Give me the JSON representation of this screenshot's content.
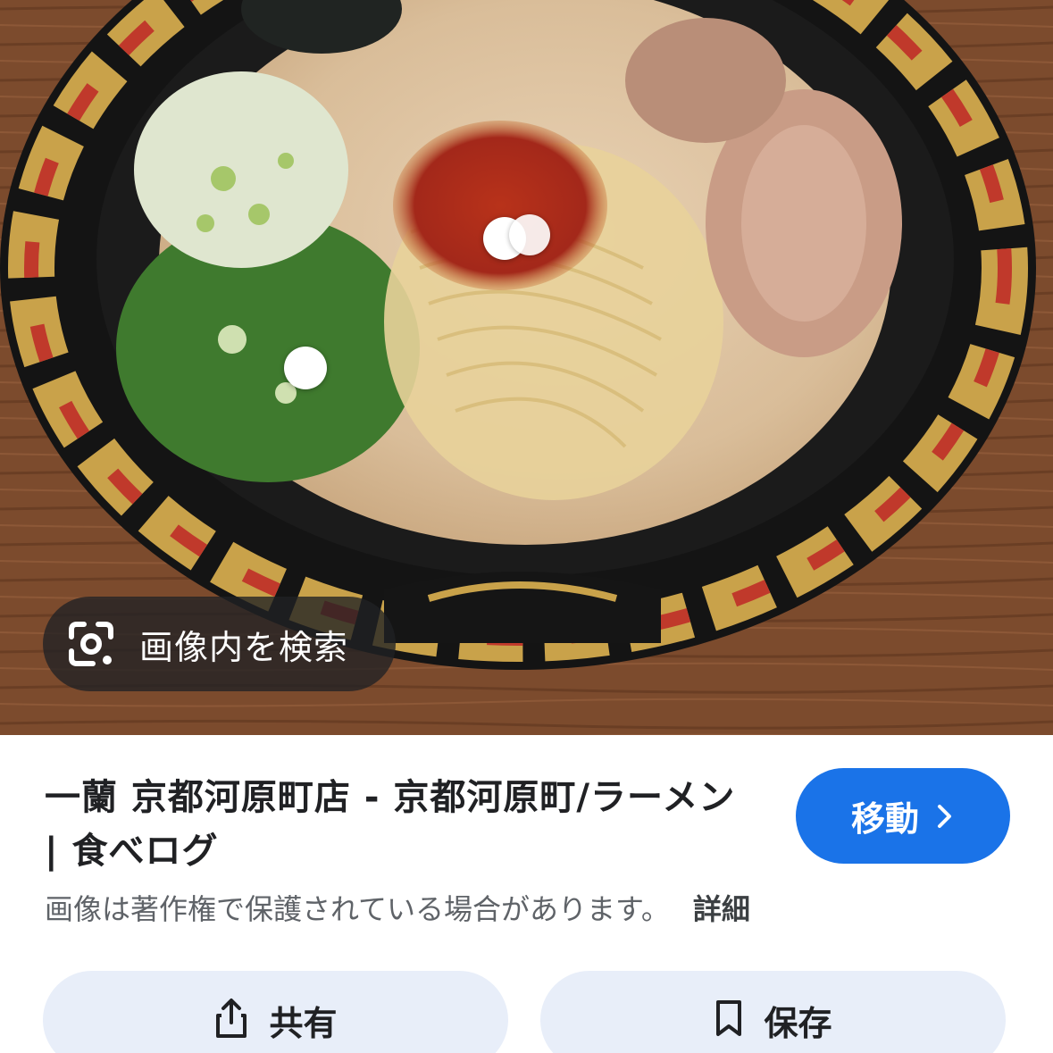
{
  "image": {
    "description_icon": "ramen-bowl-photo",
    "lens_chip": {
      "label": "画像内を検索",
      "icon": "google-lens-icon"
    }
  },
  "result": {
    "title": "一蘭 京都河原町店 - 京都河原町/ラーメン | 食べログ",
    "visit_button": {
      "label": "移動",
      "icon": "chevron-right-icon"
    },
    "copyright_notice": "画像は著作権で保護されている場合があります。",
    "details_link": "詳細"
  },
  "actions": {
    "share": {
      "label": "共有",
      "icon": "share-icon"
    },
    "save": {
      "label": "保存",
      "icon": "bookmark-icon"
    }
  },
  "colors": {
    "primary": "#1a73e8",
    "action_bg": "#e8eef9",
    "text": "#202124",
    "muted": "#5f6368"
  }
}
